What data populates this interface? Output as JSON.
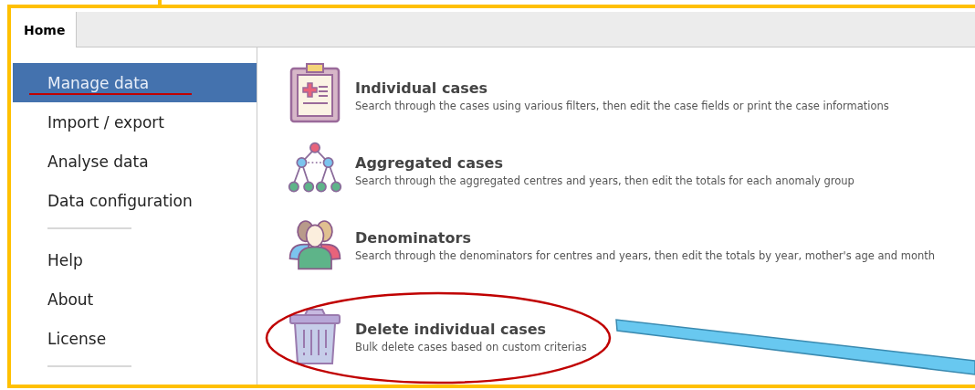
{
  "tabs": [
    {
      "label": "Home",
      "selected": true
    }
  ],
  "sidebar": {
    "sections": [
      [
        {
          "label": "Manage data",
          "selected": true
        },
        {
          "label": "Import / export",
          "selected": false
        },
        {
          "label": "Analyse data",
          "selected": false
        },
        {
          "label": "Data configuration",
          "selected": false
        }
      ],
      [
        {
          "label": "Help",
          "selected": false
        },
        {
          "label": "About",
          "selected": false
        },
        {
          "label": "License",
          "selected": false
        }
      ]
    ]
  },
  "actions": [
    {
      "kind": "clipboard",
      "title": "Individual cases",
      "description": "Search through the cases using various filters, then edit the case fields or print the case informations"
    },
    {
      "kind": "hierarchy",
      "title": "Aggregated cases",
      "description": "Search through the aggregated centres and years, then edit the totals for each anomaly group"
    },
    {
      "kind": "people",
      "title": "Denominators",
      "description": "Search through the denominators for centres and years, then edit the totals by year, mother's age and month"
    }
  ],
  "bulk_actions": [
    {
      "kind": "trash",
      "title": "Delete individual cases",
      "description": "Bulk delete cases based on custom criterias"
    }
  ]
}
